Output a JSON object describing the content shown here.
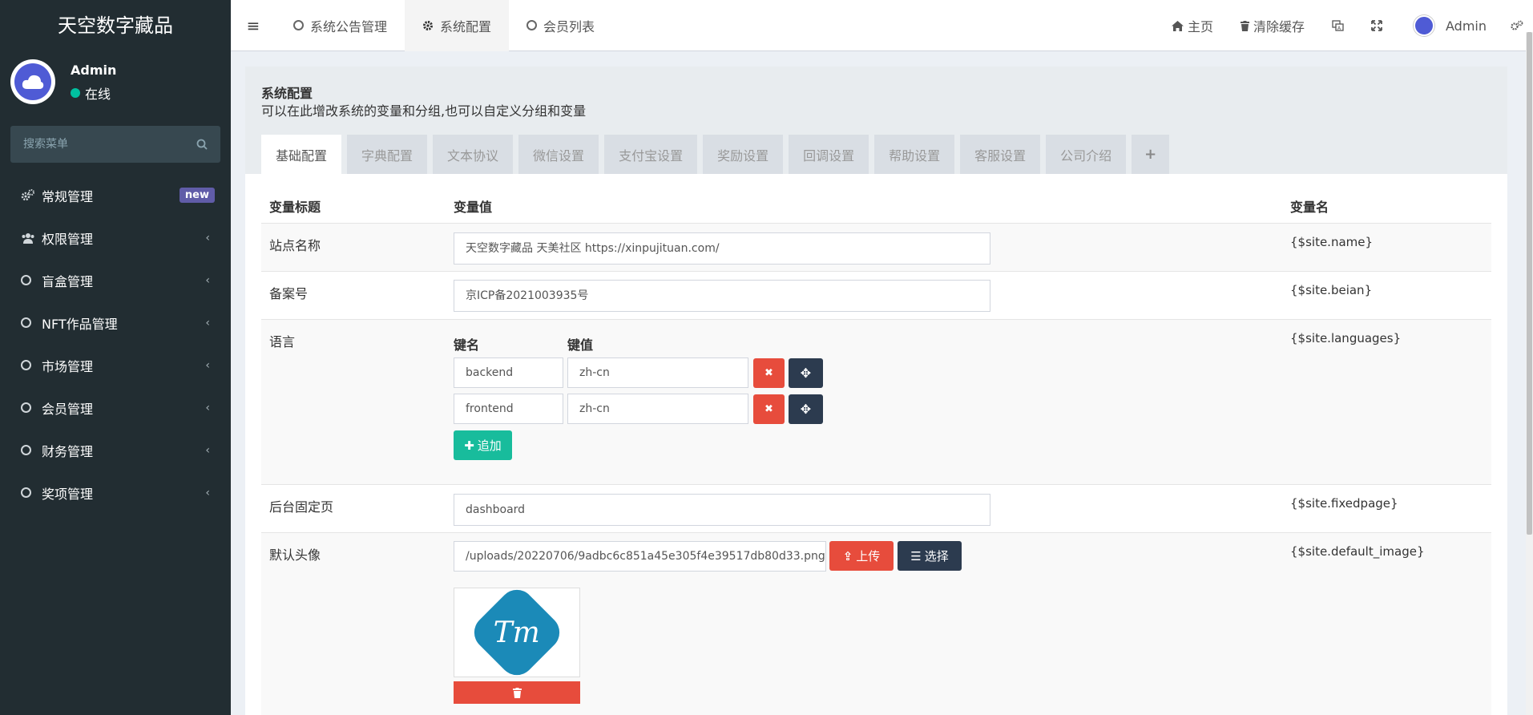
{
  "app": {
    "brand": "天空数字藏品"
  },
  "user": {
    "name": "Admin",
    "status": "在线"
  },
  "search": {
    "placeholder": "搜索菜单"
  },
  "sidebar": {
    "items": [
      {
        "label": "常规管理",
        "icon": "cogs-icon",
        "badge": "new"
      },
      {
        "label": "权限管理",
        "icon": "users-icon"
      },
      {
        "label": "盲盒管理",
        "icon": "circle-icon"
      },
      {
        "label": "NFT作品管理",
        "icon": "circle-icon"
      },
      {
        "label": "市场管理",
        "icon": "circle-icon"
      },
      {
        "label": "会员管理",
        "icon": "circle-icon"
      },
      {
        "label": "财务管理",
        "icon": "circle-icon"
      },
      {
        "label": "奖项管理",
        "icon": "circle-icon"
      }
    ]
  },
  "topbar": {
    "tabs": [
      {
        "label": "系统公告管理",
        "icon": "circle-icon"
      },
      {
        "label": "系统配置",
        "icon": "gear-icon"
      },
      {
        "label": "会员列表",
        "icon": "circle-icon"
      }
    ],
    "home": "主页",
    "clear_cache": "清除缓存",
    "admin": "Admin"
  },
  "panel": {
    "title": "系统配置",
    "description": "可以在此增改系统的变量和分组,也可以自定义分组和变量",
    "tabs": [
      "基础配置",
      "字典配置",
      "文本协议",
      "微信设置",
      "支付宝设置",
      "奖励设置",
      "回调设置",
      "帮助设置",
      "客服设置",
      "公司介绍"
    ],
    "add_tab": "+"
  },
  "table": {
    "headers": {
      "title": "变量标题",
      "value": "变量值",
      "name": "变量名"
    },
    "rows": {
      "site_name": {
        "title": "站点名称",
        "value": "天空数字藏品  天美社区  https://xinpujituan.com/",
        "var": "{$site.name}"
      },
      "beian": {
        "title": "备案号",
        "value": "京ICP备2021003935号",
        "var": "{$site.beian}"
      },
      "languages": {
        "title": "语言",
        "key_label": "键名",
        "value_label": "键值",
        "entries": [
          {
            "key": "backend",
            "value": "zh-cn"
          },
          {
            "key": "frontend",
            "value": "zh-cn"
          }
        ],
        "add_label": "追加",
        "var": "{$site.languages}"
      },
      "fixedpage": {
        "title": "后台固定页",
        "value": "dashboard",
        "var": "{$site.fixedpage}"
      },
      "default_image": {
        "title": "默认头像",
        "value": "/uploads/20220706/9adbc6c851a45e305f4e39517db80d33.png",
        "upload_label": "上传",
        "select_label": "选择",
        "preview_text": "Tm",
        "var": "{$site.default_image}"
      }
    }
  },
  "colors": {
    "sidebar_bg": "#222d32",
    "danger": "#e74c3c",
    "dark": "#2c3b4f",
    "success": "#18bc9c",
    "badge": "#605ca8"
  }
}
